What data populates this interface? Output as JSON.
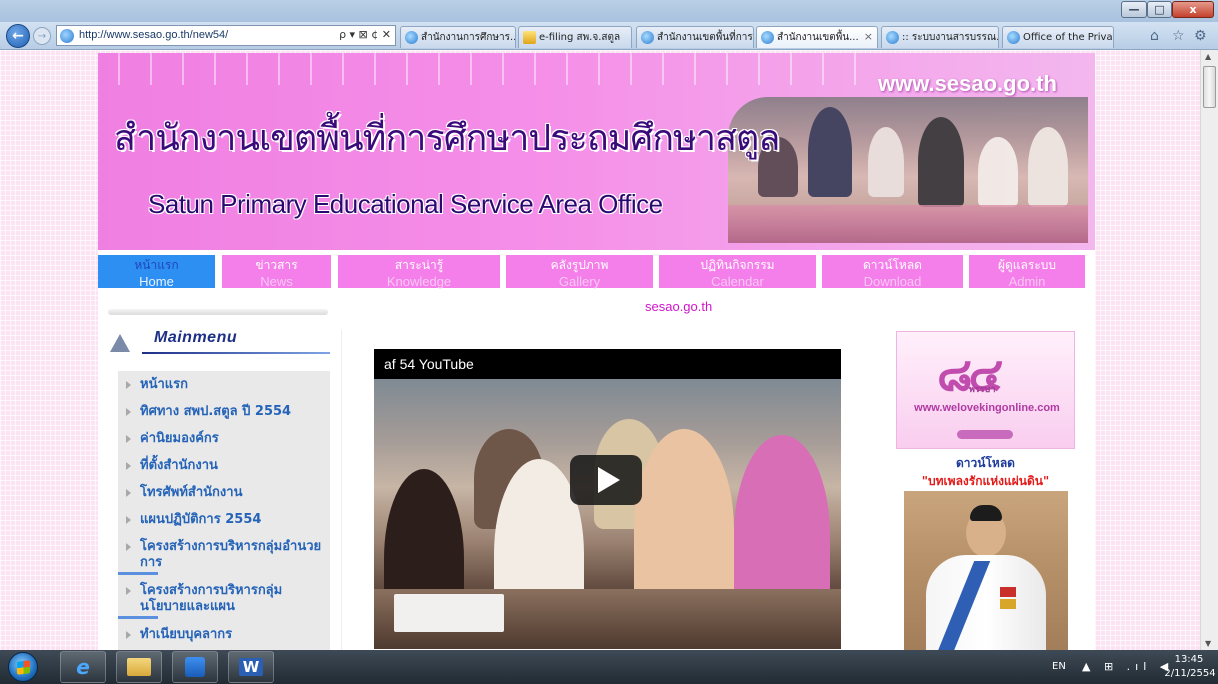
{
  "window": {
    "minimize_label": "—",
    "maximize_label": "□",
    "close_label": "x"
  },
  "browser": {
    "url": "http://www.sesao.go.th/new54/",
    "address_tools": "ρ ▾ ⊠ ¢ ✕",
    "tabs": [
      {
        "label": "สำนักงานการศึกษาร...",
        "icon": "ie-icon",
        "active": false
      },
      {
        "label": "e-filing สพ.จ.สตูล",
        "icon": "mail-icon",
        "active": false
      },
      {
        "label": "สำนักงานเขตพื้นที่การ...",
        "icon": "ie-icon",
        "active": false
      },
      {
        "label": "สำนักงานเขตพื้น...",
        "icon": "ie-icon",
        "active": true
      },
      {
        "label": ":: ระบบงานสารบรรณ...",
        "icon": "ie-icon",
        "active": false
      },
      {
        "label": "Office of the Priva...",
        "icon": "ie-icon",
        "active": false
      }
    ],
    "tab_close": "×",
    "nav_icons": {
      "home": "⌂",
      "favorites": "☆",
      "tools": "⚙"
    }
  },
  "site": {
    "banner_url": "www.sesao.go.th",
    "title_thai": "สำนักงานเขตพื้นที่การศึกษาประถมศึกษาสตูล",
    "title_english": "Satun Primary Educational Service Area Office",
    "menu": [
      {
        "th": "หน้าแรก",
        "en": "Home"
      },
      {
        "th": "ข่าวสาร",
        "en": "News"
      },
      {
        "th": "สาระน่ารู้",
        "en": "Knowledge"
      },
      {
        "th": "คลังรูปภาพ",
        "en": "Gallery"
      },
      {
        "th": "ปฏิทินกิจกรรม",
        "en": "Calendar"
      },
      {
        "th": "ดาวน์โหลด",
        "en": "Download"
      },
      {
        "th": "ผู้ดูแลระบบ",
        "en": "Admin"
      }
    ],
    "marquee": "sesao.go.th",
    "mainmenu_title": "Mainmenu",
    "sidebar_items": [
      "หน้าแรก",
      "ทิศทาง สพป.สตูล ปี 2554",
      "ค่านิยมองค์กร",
      "ที่ตั้งสำนักงาน",
      "โทรศัพท์สำนักงาน",
      "แผนปฏิบัติการ 2554",
      "โครงสร้างการบริหารกลุ่มอำนวยการ",
      "โครงสร้างการบริหารกลุ่มนโยบายและแผน",
      "ทำเนียบบุคลากร"
    ],
    "video_title": "af 54   YouTube",
    "king_logo": "๘๔",
    "king_logo_sub": "พรรษา",
    "king_url": "www.welovekingonline.com",
    "download_label": "ดาวน์โหลด",
    "download_song": "\"บทเพลงรักแห่งแผ่นดิน\""
  },
  "taskbar": {
    "language": "EN",
    "tray_icons": "▲ ⊞ .ıl ◀",
    "time": "13:45",
    "date": "2/11/2554"
  },
  "colors": {
    "banner_pink": "#f07fe2",
    "menu_pink": "#f57fea",
    "menu_home_blue": "#2d8ff2",
    "sidebar_link": "#2463b8",
    "song_red": "#e41a1a"
  }
}
